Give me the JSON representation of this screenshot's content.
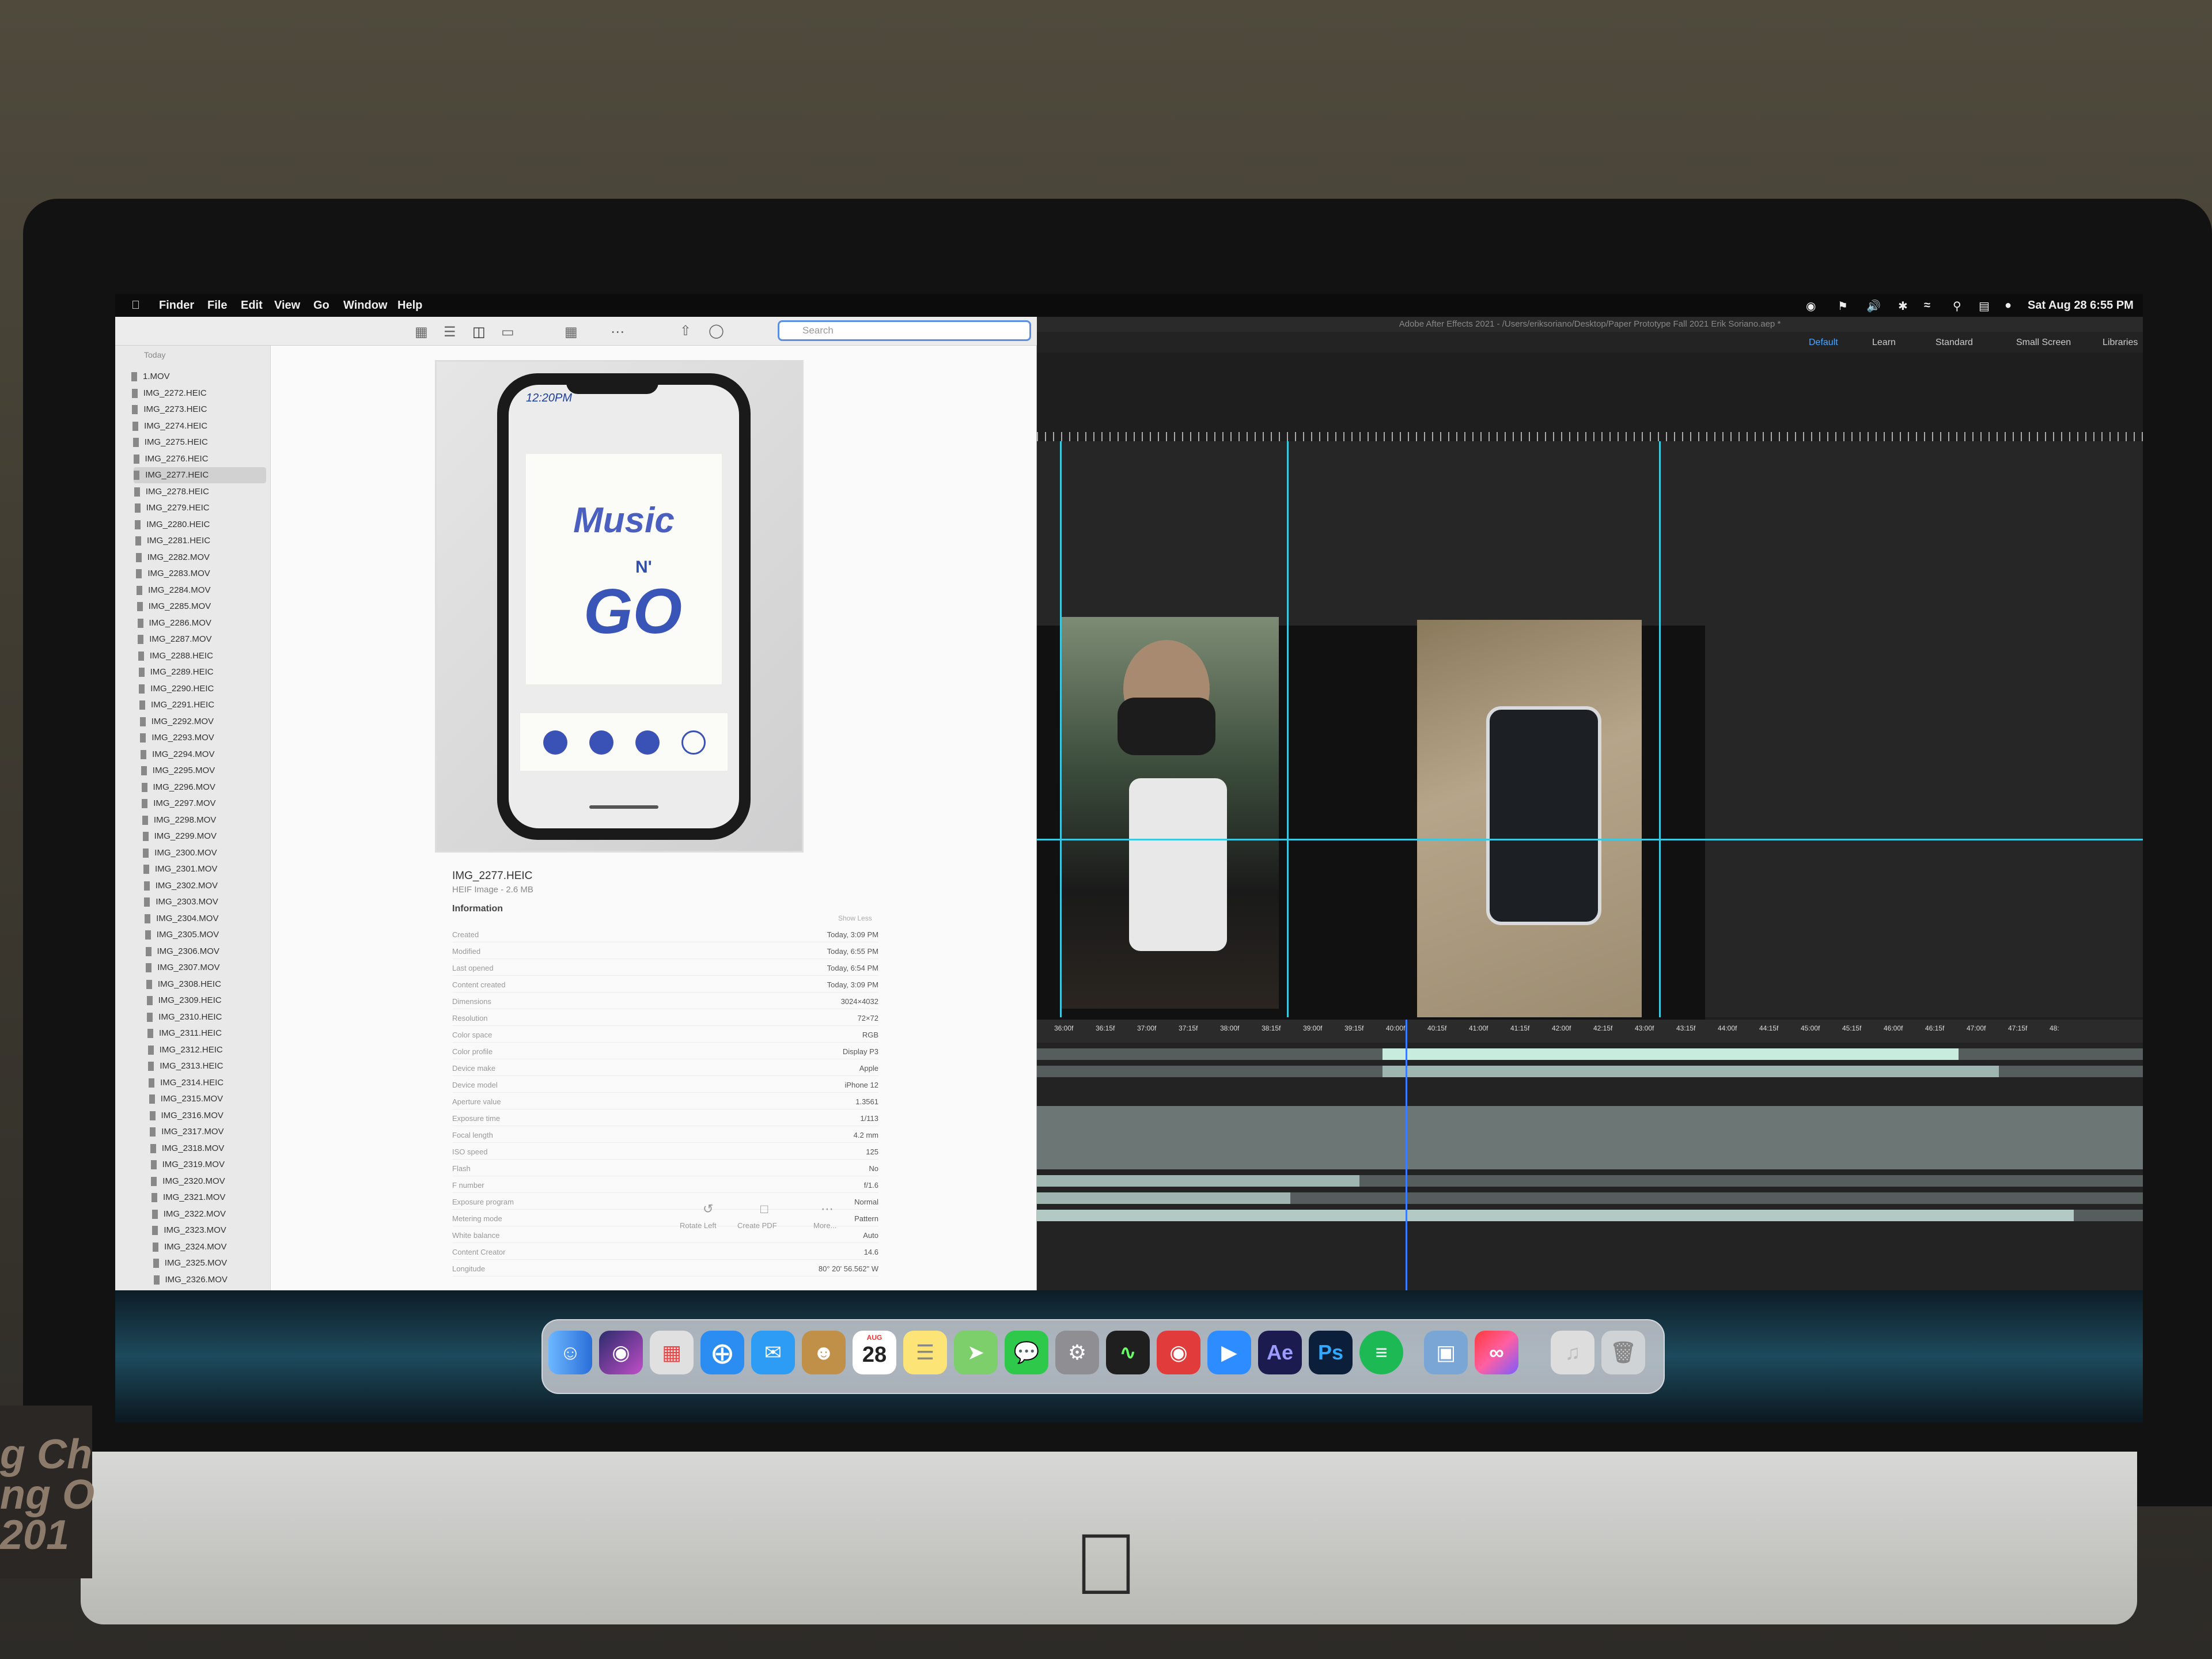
{
  "menubar": {
    "apple": "",
    "items": [
      "Finder",
      "File",
      "Edit",
      "View",
      "Go",
      "Window",
      "Help"
    ],
    "clock": "Sat Aug 28  6:55 PM"
  },
  "finder": {
    "search_placeholder": "Search",
    "sidebar_heading": "Today",
    "files": [
      "1.MOV",
      "IMG_2272.HEIC",
      "IMG_2273.HEIC",
      "IMG_2274.HEIC",
      "IMG_2275.HEIC",
      "IMG_2276.HEIC",
      "IMG_2277.HEIC",
      "IMG_2278.HEIC",
      "IMG_2279.HEIC",
      "IMG_2280.HEIC",
      "IMG_2281.HEIC",
      "IMG_2282.MOV",
      "IMG_2283.MOV",
      "IMG_2284.MOV",
      "IMG_2285.MOV",
      "IMG_2286.MOV",
      "IMG_2287.MOV",
      "IMG_2288.HEIC",
      "IMG_2289.HEIC",
      "IMG_2290.HEIC",
      "IMG_2291.HEIC",
      "IMG_2292.MOV",
      "IMG_2293.MOV",
      "IMG_2294.MOV",
      "IMG_2295.MOV",
      "IMG_2296.MOV",
      "IMG_2297.MOV",
      "IMG_2298.MOV",
      "IMG_2299.MOV",
      "IMG_2300.MOV",
      "IMG_2301.MOV",
      "IMG_2302.MOV",
      "IMG_2303.MOV",
      "IMG_2304.MOV",
      "IMG_2305.MOV",
      "IMG_2306.MOV",
      "IMG_2307.MOV",
      "IMG_2308.HEIC",
      "IMG_2309.HEIC",
      "IMG_2310.HEIC",
      "IMG_2311.HEIC",
      "IMG_2312.HEIC",
      "IMG_2313.HEIC",
      "IMG_2314.HEIC",
      "IMG_2315.MOV",
      "IMG_2316.MOV",
      "IMG_2317.MOV",
      "IMG_2318.MOV",
      "IMG_2319.MOV",
      "IMG_2320.MOV",
      "IMG_2321.MOV",
      "IMG_2322.MOV",
      "IMG_2323.MOV",
      "IMG_2324.MOV",
      "IMG_2325.MOV",
      "IMG_2326.MOV"
    ],
    "selected_file": "IMG_2277.HEIC",
    "preview": {
      "phone_time": "12:20PM",
      "drawing_title": "Music",
      "drawing_n": "N'",
      "drawing_go": "GO"
    },
    "info": {
      "name": "IMG_2277.HEIC",
      "kind": "HEIF Image - 2.6 MB",
      "heading": "Information",
      "show_less": "Show Less",
      "rows": [
        {
          "k": "Created",
          "v": "Today, 3:09 PM"
        },
        {
          "k": "Modified",
          "v": "Today, 6:55 PM"
        },
        {
          "k": "Last opened",
          "v": "Today, 6:54 PM"
        },
        {
          "k": "Content created",
          "v": "Today, 3:09 PM"
        },
        {
          "k": "Dimensions",
          "v": "3024×4032"
        },
        {
          "k": "Resolution",
          "v": "72×72"
        },
        {
          "k": "Color space",
          "v": "RGB"
        },
        {
          "k": "Color profile",
          "v": "Display P3"
        },
        {
          "k": "Device make",
          "v": "Apple"
        },
        {
          "k": "Device model",
          "v": "iPhone 12"
        },
        {
          "k": "Aperture value",
          "v": "1.3561"
        },
        {
          "k": "Exposure time",
          "v": "1/113"
        },
        {
          "k": "Focal length",
          "v": "4.2 mm"
        },
        {
          "k": "ISO speed",
          "v": "125"
        },
        {
          "k": "Flash",
          "v": "No"
        },
        {
          "k": "F number",
          "v": "f/1.6"
        },
        {
          "k": "Exposure program",
          "v": "Normal"
        },
        {
          "k": "Metering mode",
          "v": "Pattern"
        },
        {
          "k": "White balance",
          "v": "Auto"
        },
        {
          "k": "Content Creator",
          "v": "14.6"
        },
        {
          "k": "Longitude",
          "v": "80° 20' 56.562\" W"
        }
      ]
    },
    "quick_actions": [
      "Rotate Left",
      "Create PDF",
      "More..."
    ]
  },
  "ae": {
    "title": "Adobe After Effects 2021 - /Users/eriksoriano/Desktop/Paper Prototype Fall 2021 Erik Soriano.aep *",
    "workspaces": [
      "Default",
      "Learn",
      "Standard",
      "Small Screen",
      "Libraries"
    ],
    "timeline_ticks": [
      "36:00f",
      "36:15f",
      "37:00f",
      "37:15f",
      "38:00f",
      "38:15f",
      "39:00f",
      "39:15f",
      "40:00f",
      "40:15f",
      "41:00f",
      "41:15f",
      "42:00f",
      "42:15f",
      "43:00f",
      "43:15f",
      "44:00f",
      "44:15f",
      "45:00f",
      "45:15f",
      "46:00f",
      "46:15f",
      "47:00f",
      "47:15f",
      "48:"
    ]
  },
  "dock": {
    "calendar_month": "AUG",
    "calendar_day": "28",
    "ae_label": "Ae",
    "ps_label": "Ps"
  },
  "desk_text": "g Ch\nng O\n201"
}
